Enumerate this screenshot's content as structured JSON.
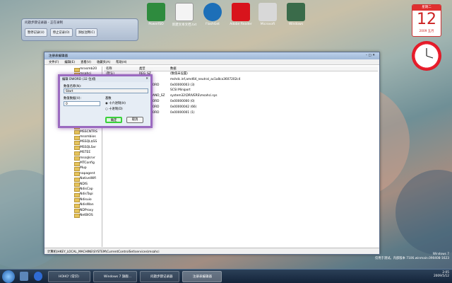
{
  "desktop": {
    "icons": [
      {
        "label": "PowerISO",
        "icon": "power-icon"
      },
      {
        "label": "新建文本文档.txt",
        "icon": "text-file-icon"
      },
      {
        "label": "FlashGet",
        "icon": "flash-icon"
      },
      {
        "label": "Adobe Reader",
        "icon": "pdf-icon"
      },
      {
        "label": "Microsoft",
        "icon": "doc-icon"
      },
      {
        "label": "Windows",
        "icon": "eye-icon"
      }
    ]
  },
  "recorder": {
    "title": "问题步骤记录器 - 正在录制",
    "pause": "暂停记录(U)",
    "stop": "停止记录(O)",
    "comment": "添加注释(C)"
  },
  "regedit": {
    "title": "注册表编辑器",
    "menu": [
      "文件(F)",
      "编辑(E)",
      "查看(V)",
      "收藏夹(A)",
      "帮助(H)"
    ],
    "tree": [
      "mrxsmb20",
      "msahci",
      "MSDTC",
      "msdsm",
      "MSDTC Bridge",
      "msisadrv",
      "MSiSCSI",
      "msiserver",
      "MSKSSRV",
      "MSPCLOCK",
      "MSPQM",
      "MsRPC",
      "MSSCNTRS",
      "mssmbios",
      "MSSQL$SS",
      "MSSQLSer",
      "MSTEE",
      "mssqlsrvr",
      "MTConfig",
      "Mup",
      "napagent",
      "NativeWifi",
      "NDIS",
      "NdisCap",
      "NdisTapi",
      "Ndisuio",
      "NdisWan",
      "NDProxy",
      "NetBIOS"
    ],
    "columns": [
      "名称",
      "类型",
      "数据"
    ],
    "rows": [
      {
        "name": "(默认)",
        "type": "REG_SZ",
        "data": "(数值未设置)"
      },
      {
        "name": "DisplayN...",
        "type": "REG_SZ",
        "data": "mshdc.inf,amd64_neutral_ac1a8ca3607202c4"
      },
      {
        "name": "ErrorCon...",
        "type": "REG_DWORD",
        "data": "0x00000003 (3)"
      },
      {
        "name": "Group",
        "type": "REG_SZ",
        "data": "SCSI Miniport"
      },
      {
        "name": "ImagePath",
        "type": "REG_EXPAND_SZ",
        "data": "system32\\DRIVERS\\msahci.sys"
      },
      {
        "name": "Start",
        "type": "REG_DWORD",
        "data": "0x00000000 (0)"
      },
      {
        "name": "Tag",
        "type": "REG_DWORD",
        "data": "0x00000042 (66)"
      },
      {
        "name": "Type",
        "type": "REG_DWORD",
        "data": "0x00000001 (1)"
      }
    ],
    "status": "计算机\\HKEY_LOCAL_MACHINE\\SYSTEM\\CurrentControlSet\\services\\msahci"
  },
  "dialog": {
    "title": "编辑 DWORD (32 位)值",
    "name_label": "数值名称(N):",
    "name_value": "Start",
    "data_label": "数值数据(V):",
    "data_value": "0",
    "base_label": "基数",
    "hex": "十六进制(H)",
    "dec": "十进制(D)",
    "ok": "确定",
    "cancel": "取消"
  },
  "calendar": {
    "weekday": "星期二",
    "day": "12",
    "month": "2009 五月"
  },
  "taskbar": {
    "items": [
      "HOHO' (常识)",
      "Windows 7 旗舰...",
      "问题步骤记录器",
      "注册表编辑器"
    ],
    "tray_time": "2:05",
    "tray_date": "2009/5/12"
  },
  "watermark": {
    "line1": "Windows 7",
    "line2": "仅用于测试。内部版本 7106.winmain.090408-1623"
  }
}
